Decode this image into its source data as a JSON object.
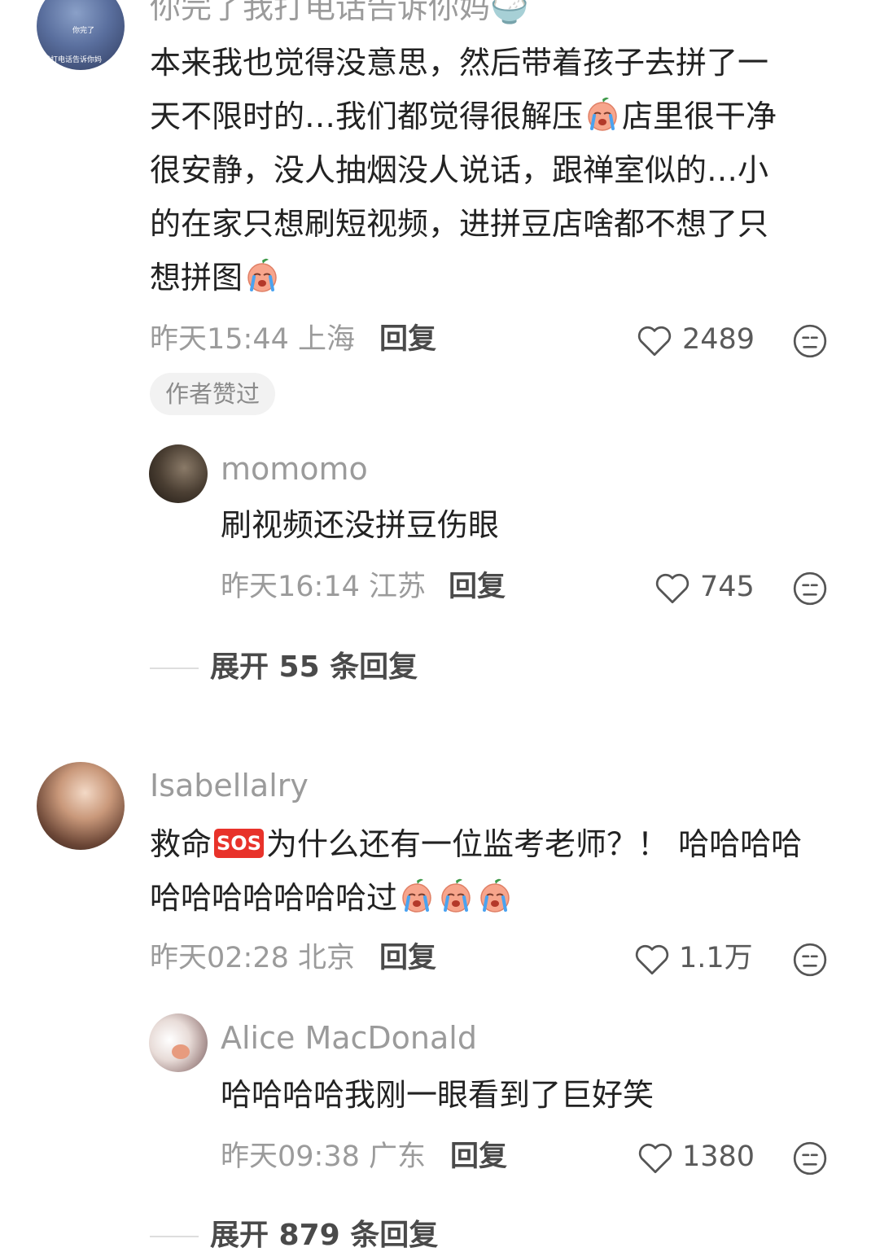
{
  "comments": [
    {
      "username": "你完了我打电话告诉你妈🍚",
      "avatar_text_1": "你完了",
      "avatar_text_2": "我打电话告诉你妈",
      "lines": [
        "本来我也觉得没意思，然后带着孩子去拼了一",
        "天不限时的…我们都觉得很解压",
        "店里很干净",
        "很安静，没人抽烟没人说话，跟禅室似的…小",
        "的在家只想刷短视频，进拼豆店啥都不想了只",
        "想拼图"
      ],
      "time": "昨天15:44",
      "location": "上海",
      "reply_label": "回复",
      "likes": "2489",
      "author_liked_tag": "作者赞过",
      "replies": [
        {
          "username": "momomo",
          "text": "刷视频还没拼豆伤眼",
          "time": "昨天16:14",
          "location": "江苏",
          "reply_label": "回复",
          "likes": "745"
        }
      ],
      "expand_label": "展开 55 条回复"
    },
    {
      "username": "Isabellalry",
      "line1_a": "救命",
      "sos_label": "SOS",
      "line1_b": "为什么还有一位监考老师？！ 哈哈哈哈",
      "line2": "哈哈哈哈哈哈哈过",
      "time": "昨天02:28",
      "location": "北京",
      "reply_label": "回复",
      "likes": "1.1万",
      "replies": [
        {
          "username": "Alice MacDonald",
          "text": "哈哈哈哈我刚一眼看到了巨好笑",
          "time": "昨天09:38",
          "location": "广东",
          "reply_label": "回复",
          "likes": "1380"
        }
      ],
      "expand_label": "展开 879 条回复"
    }
  ],
  "icons": {
    "heart": "heart-outline-icon",
    "dislike": "meh-face-icon",
    "emoji": "crying-face-emoji"
  },
  "colors": {
    "muted_text": "#9b9b9b",
    "body_text": "#222222",
    "tag_bg": "#f2f2f2",
    "sos_red": "#e8322a"
  }
}
